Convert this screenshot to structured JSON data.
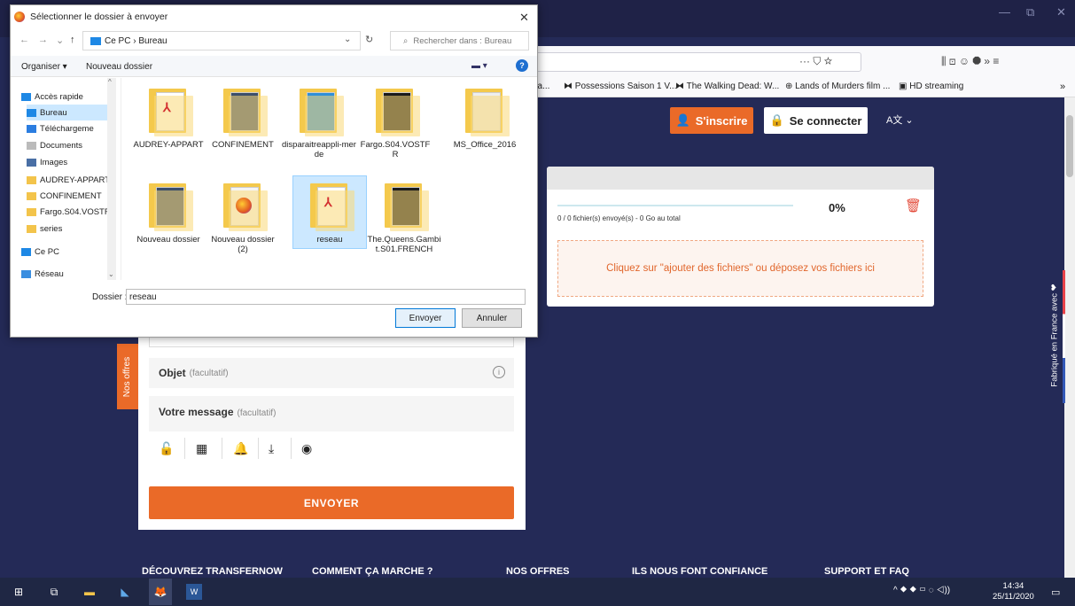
{
  "dialog": {
    "title": "Sélectionner le dossier à envoyer",
    "breadcrumb": "Ce PC  ›  Bureau",
    "search_placeholder": "Rechercher dans : Bureau",
    "organise": "Organiser ▾",
    "new_folder": "Nouveau dossier",
    "nav": [
      {
        "label": "Accès rapide",
        "icon": "star-icon",
        "selected": false
      },
      {
        "label": "Bureau",
        "icon": "desktop-icon",
        "selected": true
      },
      {
        "label": "Téléchargeme",
        "icon": "download-icon",
        "selected": false
      },
      {
        "label": "Documents",
        "icon": "documents-icon",
        "selected": false
      },
      {
        "label": "Images",
        "icon": "images-icon",
        "selected": false
      },
      {
        "label": "AUDREY-APPART",
        "icon": "folder-icon",
        "selected": false
      },
      {
        "label": "CONFINEMENT",
        "icon": "folder-icon",
        "selected": false
      },
      {
        "label": "Fargo.S04.VOSTF",
        "icon": "folder-icon",
        "selected": false
      },
      {
        "label": "series",
        "icon": "folder-icon",
        "selected": false
      },
      {
        "label": "Ce PC",
        "icon": "pc-icon",
        "selected": false
      },
      {
        "label": "Réseau",
        "icon": "network-icon",
        "selected": false
      }
    ],
    "files": [
      {
        "name": "AUDREY-APPART",
        "type": "pdf-folder"
      },
      {
        "name": "CONFINEMENT",
        "type": "photo-folder"
      },
      {
        "name": "disparaitreappli-merde",
        "type": "blue-folder"
      },
      {
        "name": "Fargo.S04.VOSTFR",
        "type": "dark-folder"
      },
      {
        "name": "MS_Office_2016",
        "type": "doc-folder"
      },
      {
        "name": "Nouveau dossier",
        "type": "photo-folder"
      },
      {
        "name": "Nouveau dossier (2)",
        "type": "firefox-folder"
      },
      {
        "name": "reseau",
        "type": "pdf-folder",
        "selected": true
      },
      {
        "name": "The.Queens.Gambit.S01.FRENCH",
        "type": "dark-folder"
      }
    ],
    "folder_label": "Dossier :",
    "folder_value": "reseau",
    "ok_label": "Envoyer",
    "cancel_label": "Annuler"
  },
  "browser": {
    "url_icons": "··· ⛉ ☆",
    "bookmarks": [
      "ea...",
      "Possessions Saison 1 V...",
      "The Walking Dead: W...",
      "Lands of Murders film ...",
      "HD streaming"
    ],
    "toolbar_right": "⫼  ⊡  ☺  ⯃  »  ≡"
  },
  "site": {
    "signup": "S'inscrire",
    "login": "Se connecter",
    "lang": "A文 ⌄",
    "progress_pct": "0%",
    "status": "0 / 0 fichier(s) envoyé(s) - 0 Go au total",
    "dropzone": "Cliquez sur \"ajouter des fichiers\" ou déposez vos fichiers ici",
    "objet": "Objet",
    "objet_opt": "(facultatif)",
    "message": "Votre message",
    "message_opt": "(facultatif)",
    "submit": "ENVOYER",
    "side_tab": "Nos offres",
    "fr_tab": "Fabriqué en France avec ❤",
    "footer": [
      "DÉCOUVREZ TRANSFERNOW",
      "COMMENT ÇA MARCHE ?",
      "NOS OFFRES",
      "ILS NOUS FONT CONFIANCE",
      "SUPPORT ET FAQ"
    ]
  },
  "taskbar": {
    "time": "14:34",
    "date": "25/11/2020",
    "tray": "^  ⯁  ⯁  ▭  ◌  ◁))"
  }
}
